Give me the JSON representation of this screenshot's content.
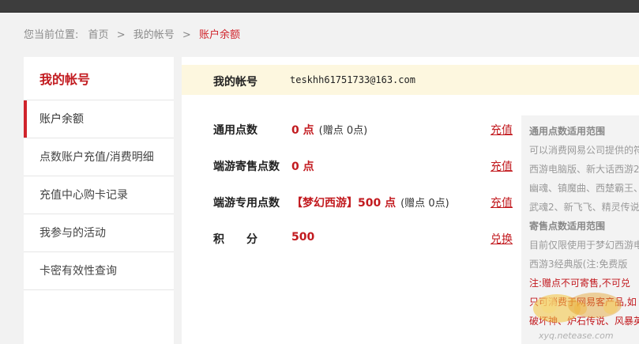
{
  "breadcrumb": {
    "prefix": "您当前位置:",
    "home": "首页",
    "sep1": ">",
    "account": "我的帐号",
    "sep2": ">",
    "current": "账户余额"
  },
  "sidebar": {
    "title": "我的帐号",
    "items": [
      {
        "label": "账户余额"
      },
      {
        "label": "点数账户充值/消费明细"
      },
      {
        "label": "充值中心购卡记录"
      },
      {
        "label": "我参与的活动"
      },
      {
        "label": "卡密有效性查询"
      }
    ]
  },
  "account": {
    "label": "我的帐号",
    "value": "teskhh61751733@163.com"
  },
  "balances": {
    "general": {
      "label": "通用点数",
      "value": "0 点",
      "gift": "(赠点 0点)",
      "action": "充值"
    },
    "consign": {
      "label": "端游寄售点数",
      "value": "0 点",
      "action": "充值"
    },
    "dedicated": {
      "label": "端游专用点数",
      "game": "【梦幻西游】",
      "value": "500 点",
      "gift": "(赠点 0点)",
      "action": "充值"
    },
    "points": {
      "label": "积　　分",
      "value": "500",
      "action": "兑换"
    }
  },
  "side_panel": {
    "lines": [
      "通用点数适用范围",
      "可以消费网易公司提供的符",
      "西游电脑版、新大话西游2",
      "幽魂、镇魔曲、西楚霸王、",
      "武魂2、新飞飞、精灵传说",
      "寄售点数适用范围",
      "目前仅限使用于梦幻西游电",
      "西游3经典版(注:免费版",
      "注:赠点不可寄售,不可兑",
      "只可消费于网易客产品,如",
      "破坏神、炉石传说、风暴英"
    ]
  },
  "watermark": {
    "text": "xyq.netease.com"
  },
  "colors": {
    "accent": "#c21a1f",
    "topbar": "#3d3d3d",
    "account_bar": "#fdf7df",
    "page_bg": "#f2f2f2"
  }
}
